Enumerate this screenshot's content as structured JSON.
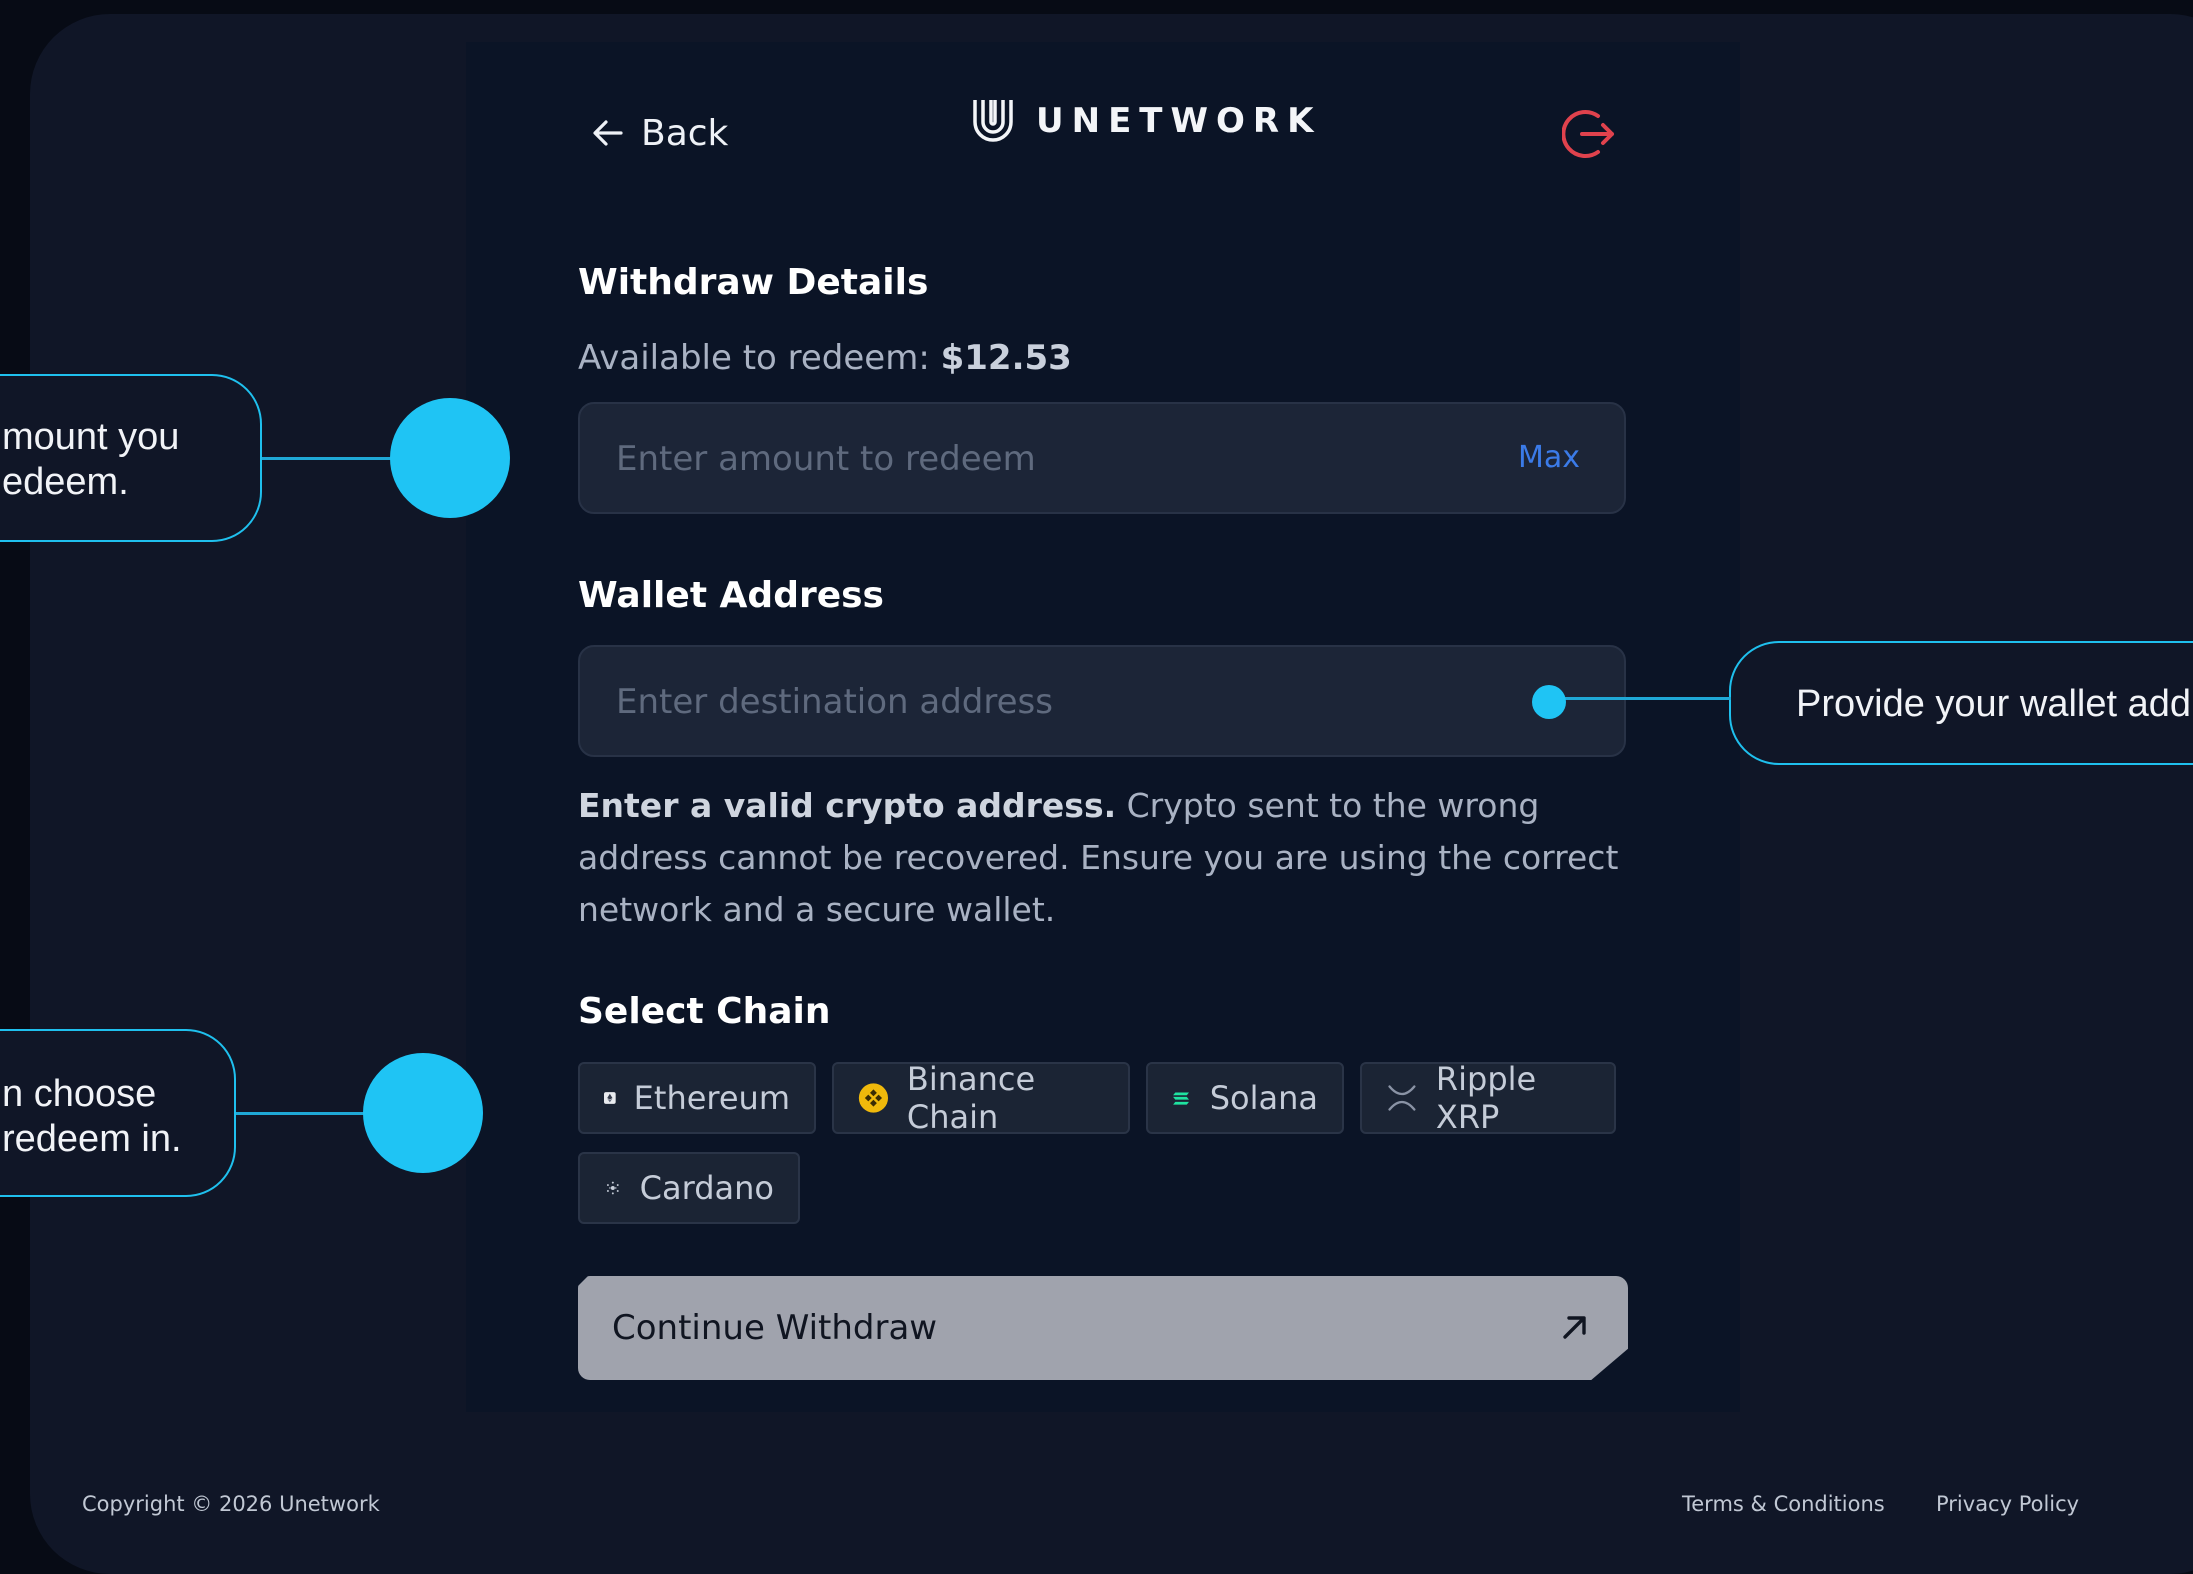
{
  "header": {
    "back_label": "Back",
    "logo_text": "UNETWORK"
  },
  "withdraw": {
    "title": "Withdraw Details",
    "available_label": "Available to redeem:",
    "available_amount": "$12.53",
    "amount_placeholder": "Enter amount to redeem",
    "max_label": "Max"
  },
  "wallet": {
    "title": "Wallet Address",
    "address_placeholder": "Enter destination address",
    "warning_bold": "Enter a valid crypto address.",
    "warning_text": "Crypto sent to the wrong address cannot be recovered. Ensure you are using the correct network and a secure wallet."
  },
  "chain": {
    "title": "Select Chain",
    "options": [
      {
        "label": "Ethereum",
        "icon": "ethereum-icon"
      },
      {
        "label": "Binance Chain",
        "icon": "binance-icon"
      },
      {
        "label": "Solana",
        "icon": "solana-icon"
      },
      {
        "label": "Ripple XRP",
        "icon": "ripple-icon"
      },
      {
        "label": "Cardano",
        "icon": "cardano-icon"
      }
    ]
  },
  "continue_label": "Continue Withdraw",
  "callouts": {
    "amount_line1": "mount you",
    "amount_line2": "edeem.",
    "wallet_text": "Provide your wallet add",
    "chain_line1": "n choose",
    "chain_line2": "redeem in."
  },
  "footer": {
    "copyright": "Copyright © 2026 Unetwork",
    "terms": "Terms & Conditions",
    "privacy": "Privacy Policy"
  },
  "colors": {
    "accent": "#1fc4f4",
    "link_blue": "#3b7be8",
    "logout_red": "#e0424d",
    "background": "#070b15"
  }
}
